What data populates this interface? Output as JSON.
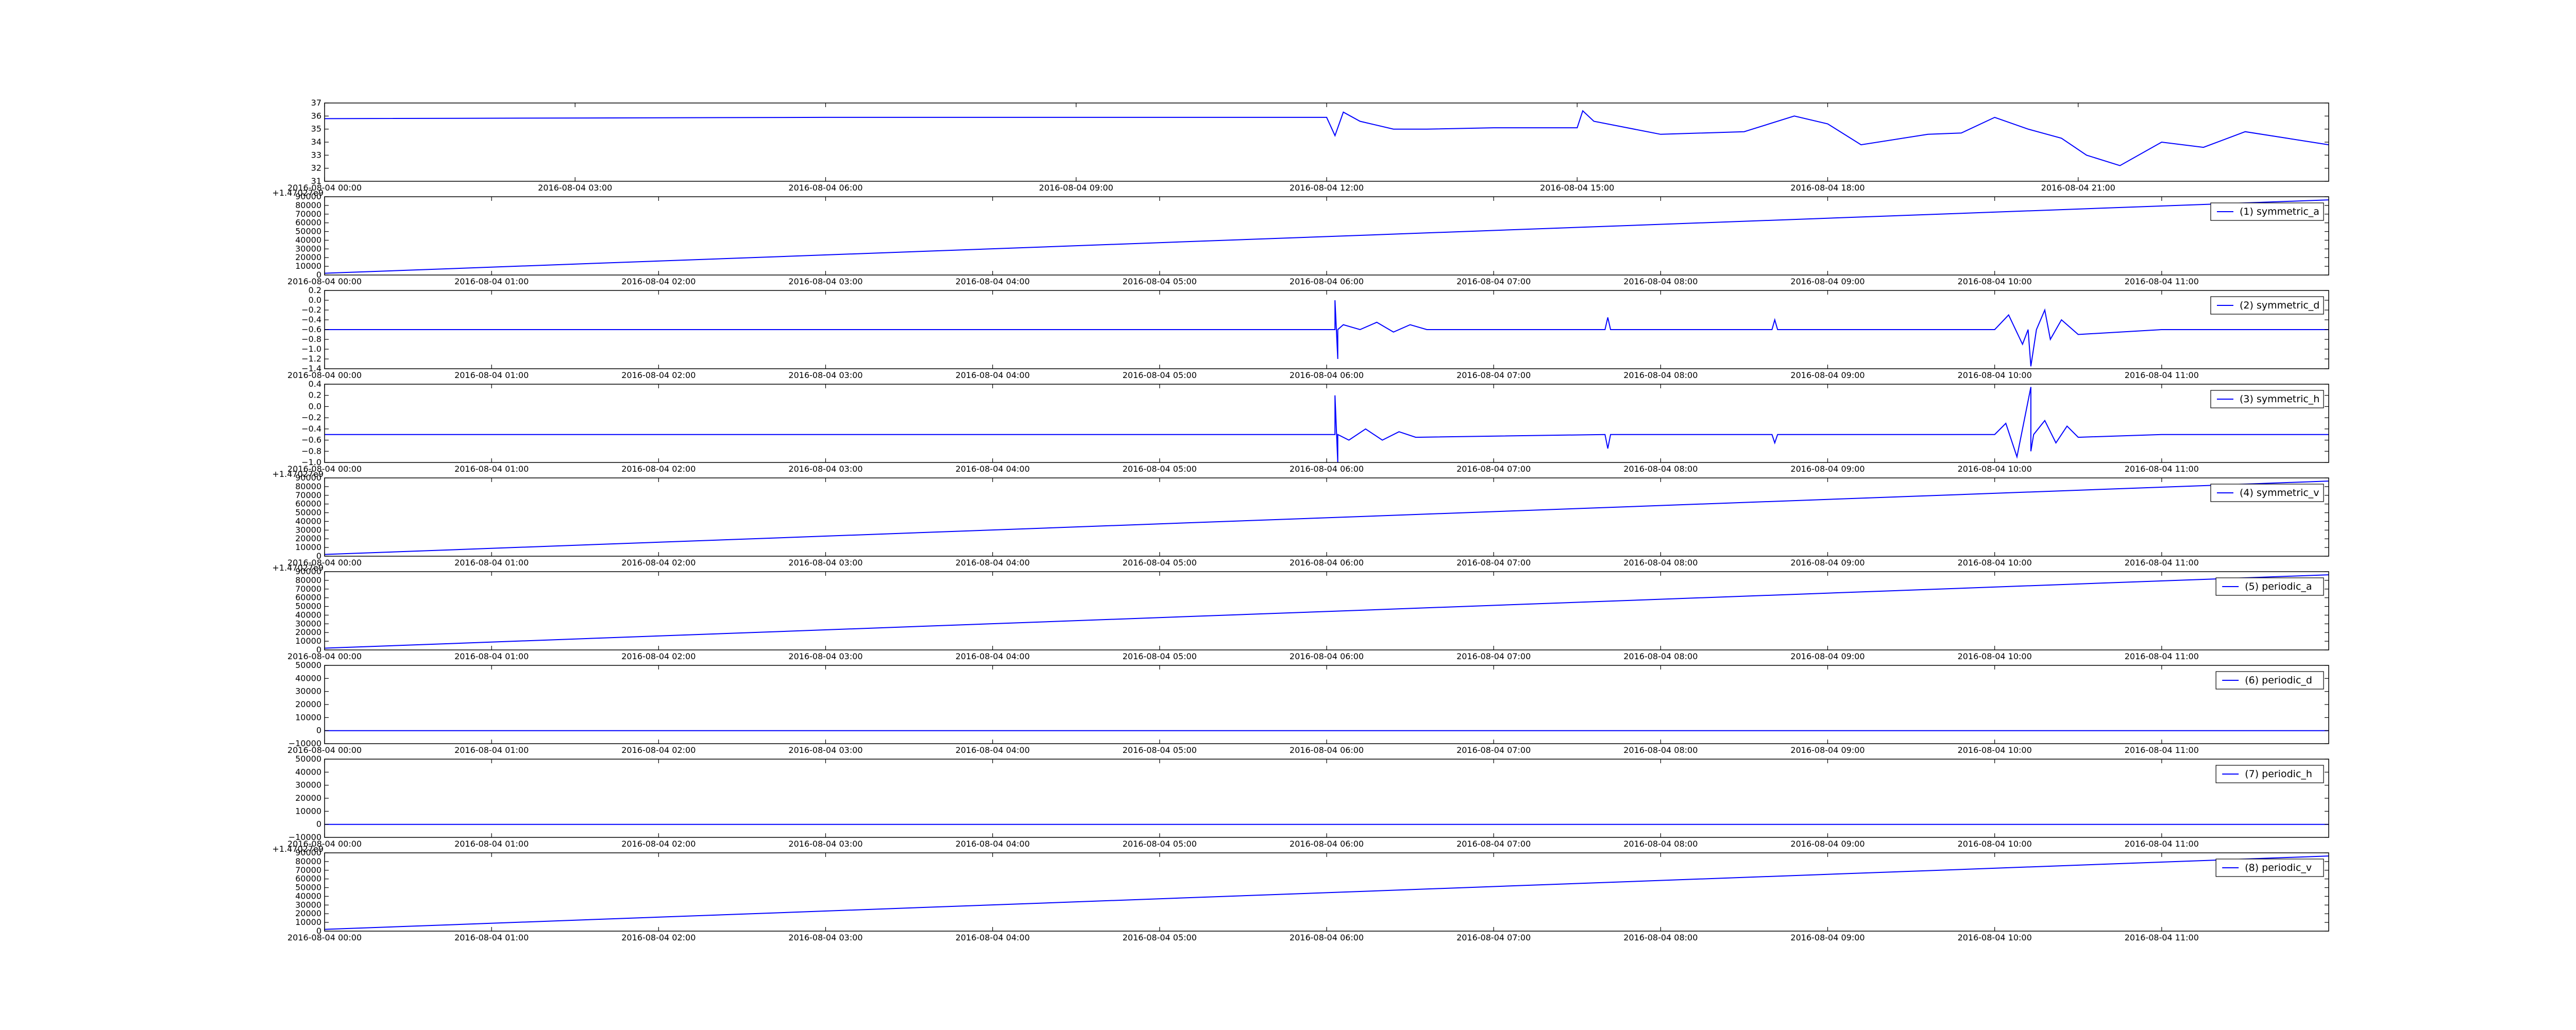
{
  "chart_data": [
    {
      "type": "line",
      "title": "",
      "xlabel": "",
      "ylabel": "",
      "grid": false,
      "legend": "",
      "color": "#0000ff",
      "ylim": [
        31,
        37
      ],
      "yticks": [
        "31",
        "32",
        "33",
        "34",
        "35",
        "36",
        "37"
      ],
      "xlim": [
        "2016-08-04 00:00",
        "2016-08-05 00:00"
      ],
      "xticks": [
        "2016-08-04 00:00",
        "2016-08-04 03:00",
        "2016-08-04 06:00",
        "2016-08-04 09:00",
        "2016-08-04 12:00",
        "2016-08-04 15:00",
        "2016-08-04 18:00",
        "2016-08-04 21:00"
      ],
      "offset_label": "",
      "series": [
        {
          "name": "",
          "x": [
            "2016-08-04 00:00",
            "2016-08-04 06:00",
            "2016-08-04 12:00",
            "2016-08-04 12:06",
            "2016-08-04 12:12",
            "2016-08-04 12:24",
            "2016-08-04 12:48",
            "2016-08-04 13:12",
            "2016-08-04 14:00",
            "2016-08-04 15:00",
            "2016-08-04 15:04",
            "2016-08-04 15:12",
            "2016-08-04 16:00",
            "2016-08-04 17:00",
            "2016-08-04 17:36",
            "2016-08-04 18:00",
            "2016-08-04 18:24",
            "2016-08-04 19:12",
            "2016-08-04 19:36",
            "2016-08-04 20:00",
            "2016-08-04 20:24",
            "2016-08-04 20:48",
            "2016-08-04 21:06",
            "2016-08-04 21:30",
            "2016-08-04 22:00",
            "2016-08-04 22:30",
            "2016-08-04 23:00",
            "2016-08-04 23:30",
            "2016-08-05 00:00"
          ],
          "y": [
            35.8,
            35.9,
            35.9,
            34.5,
            36.3,
            35.6,
            35.0,
            35.0,
            35.1,
            35.1,
            36.4,
            35.6,
            34.6,
            34.8,
            36.0,
            35.4,
            33.8,
            34.6,
            34.7,
            35.9,
            35.0,
            34.3,
            33.0,
            32.2,
            34.0,
            33.6,
            34.8,
            34.3,
            33.8
          ]
        }
      ]
    },
    {
      "type": "line",
      "title": "",
      "xlabel": "",
      "ylabel": "",
      "grid": false,
      "legend": "right",
      "color": "#0000ff",
      "ylim": [
        0,
        90000
      ],
      "yticks": [
        "0",
        "10000",
        "20000",
        "30000",
        "40000",
        "50000",
        "60000",
        "70000",
        "80000",
        "90000"
      ],
      "xlim": [
        "2016-08-04 00:00",
        "2016-08-04 12:00"
      ],
      "xticks": [
        "2016-08-04 00:00",
        "2016-08-04 01:00",
        "2016-08-04 02:00",
        "2016-08-04 03:00",
        "2016-08-04 04:00",
        "2016-08-04 05:00",
        "2016-08-04 06:00",
        "2016-08-04 07:00",
        "2016-08-04 08:00",
        "2016-08-04 09:00",
        "2016-08-04 10:00",
        "2016-08-04 11:00"
      ],
      "offset_label": "+1.47027e9",
      "series": [
        {
          "name": "(1) symmetric_a",
          "x": [
            "2016-08-04 00:00",
            "2016-08-04 12:00"
          ],
          "y": [
            2000,
            86400
          ]
        }
      ]
    },
    {
      "type": "line",
      "title": "",
      "xlabel": "",
      "ylabel": "",
      "grid": false,
      "legend": "right",
      "color": "#0000ff",
      "ylim": [
        -1.4,
        0.2
      ],
      "yticks": [
        "−1.4",
        "−1.2",
        "−1.0",
        "−0.8",
        "−0.6",
        "−0.4",
        "−0.2",
        "0.0",
        "0.2"
      ],
      "xlim": [
        "2016-08-04 00:00",
        "2016-08-04 12:00"
      ],
      "xticks": [
        "2016-08-04 00:00",
        "2016-08-04 01:00",
        "2016-08-04 02:00",
        "2016-08-04 03:00",
        "2016-08-04 04:00",
        "2016-08-04 05:00",
        "2016-08-04 06:00",
        "2016-08-04 07:00",
        "2016-08-04 08:00",
        "2016-08-04 09:00",
        "2016-08-04 10:00",
        "2016-08-04 11:00"
      ],
      "offset_label": "",
      "series": [
        {
          "name": "(2) symmetric_d",
          "x": [
            "2016-08-04 00:00",
            "2016-08-04 06:03",
            "2016-08-04 06:03",
            "2016-08-04 06:04",
            "2016-08-04 06:04",
            "2016-08-04 06:06",
            "2016-08-04 06:12",
            "2016-08-04 06:18",
            "2016-08-04 06:24",
            "2016-08-04 06:30",
            "2016-08-04 06:36",
            "2016-08-04 07:40",
            "2016-08-04 07:41",
            "2016-08-04 07:42",
            "2016-08-04 07:44",
            "2016-08-04 08:40",
            "2016-08-04 08:41",
            "2016-08-04 08:42",
            "2016-08-04 10:00",
            "2016-08-04 10:05",
            "2016-08-04 10:10",
            "2016-08-04 10:12",
            "2016-08-04 10:13",
            "2016-08-04 10:15",
            "2016-08-04 10:18",
            "2016-08-04 10:20",
            "2016-08-04 10:24",
            "2016-08-04 10:30",
            "2016-08-04 11:00",
            "2016-08-04 12:00"
          ],
          "y": [
            -0.6,
            -0.6,
            0.0,
            -1.2,
            -0.6,
            -0.5,
            -0.6,
            -0.45,
            -0.65,
            -0.5,
            -0.6,
            -0.6,
            -0.35,
            -0.6,
            -0.6,
            -0.6,
            -0.4,
            -0.6,
            -0.6,
            -0.3,
            -0.9,
            -0.6,
            -1.35,
            -0.6,
            -0.2,
            -0.8,
            -0.4,
            -0.7,
            -0.6,
            -0.6
          ]
        }
      ]
    },
    {
      "type": "line",
      "title": "",
      "xlabel": "",
      "ylabel": "",
      "grid": false,
      "legend": "right",
      "color": "#0000ff",
      "ylim": [
        -1.0,
        0.4
      ],
      "yticks": [
        "−1.0",
        "−0.8",
        "−0.6",
        "−0.4",
        "−0.2",
        "0.0",
        "0.2",
        "0.4"
      ],
      "xlim": [
        "2016-08-04 00:00",
        "2016-08-04 12:00"
      ],
      "xticks": [
        "2016-08-04 00:00",
        "2016-08-04 01:00",
        "2016-08-04 02:00",
        "2016-08-04 03:00",
        "2016-08-04 04:00",
        "2016-08-04 05:00",
        "2016-08-04 06:00",
        "2016-08-04 07:00",
        "2016-08-04 08:00",
        "2016-08-04 09:00",
        "2016-08-04 10:00",
        "2016-08-04 11:00"
      ],
      "offset_label": "",
      "series": [
        {
          "name": "(3) symmetric_h",
          "x": [
            "2016-08-04 00:00",
            "2016-08-04 06:03",
            "2016-08-04 06:03",
            "2016-08-04 06:04",
            "2016-08-04 06:04",
            "2016-08-04 06:08",
            "2016-08-04 06:14",
            "2016-08-04 06:20",
            "2016-08-04 06:26",
            "2016-08-04 06:32",
            "2016-08-04 07:40",
            "2016-08-04 07:41",
            "2016-08-04 07:42",
            "2016-08-04 08:40",
            "2016-08-04 08:41",
            "2016-08-04 08:42",
            "2016-08-04 10:00",
            "2016-08-04 10:04",
            "2016-08-04 10:08",
            "2016-08-04 10:13",
            "2016-08-04 10:13",
            "2016-08-04 10:14",
            "2016-08-04 10:18",
            "2016-08-04 10:22",
            "2016-08-04 10:26",
            "2016-08-04 10:30",
            "2016-08-04 11:00",
            "2016-08-04 12:00"
          ],
          "y": [
            -0.5,
            -0.5,
            0.2,
            -1.0,
            -0.5,
            -0.6,
            -0.4,
            -0.6,
            -0.45,
            -0.55,
            -0.5,
            -0.75,
            -0.5,
            -0.5,
            -0.65,
            -0.5,
            -0.5,
            -0.3,
            -0.9,
            0.35,
            -0.8,
            -0.5,
            -0.25,
            -0.65,
            -0.35,
            -0.55,
            -0.5,
            -0.5
          ]
        }
      ]
    },
    {
      "type": "line",
      "title": "",
      "xlabel": "",
      "ylabel": "",
      "grid": false,
      "legend": "right",
      "color": "#0000ff",
      "ylim": [
        0,
        90000
      ],
      "yticks": [
        "0",
        "10000",
        "20000",
        "30000",
        "40000",
        "50000",
        "60000",
        "70000",
        "80000",
        "90000"
      ],
      "xlim": [
        "2016-08-04 00:00",
        "2016-08-04 12:00"
      ],
      "xticks": [
        "2016-08-04 00:00",
        "2016-08-04 01:00",
        "2016-08-04 02:00",
        "2016-08-04 03:00",
        "2016-08-04 04:00",
        "2016-08-04 05:00",
        "2016-08-04 06:00",
        "2016-08-04 07:00",
        "2016-08-04 08:00",
        "2016-08-04 09:00",
        "2016-08-04 10:00",
        "2016-08-04 11:00"
      ],
      "offset_label": "+1.47027e9",
      "series": [
        {
          "name": "(4) symmetric_v",
          "x": [
            "2016-08-04 00:00",
            "2016-08-04 12:00"
          ],
          "y": [
            2000,
            86400
          ]
        }
      ]
    },
    {
      "type": "line",
      "title": "",
      "xlabel": "",
      "ylabel": "",
      "grid": false,
      "legend": "right",
      "color": "#0000ff",
      "ylim": [
        0,
        90000
      ],
      "yticks": [
        "0",
        "10000",
        "20000",
        "30000",
        "40000",
        "50000",
        "60000",
        "70000",
        "80000",
        "90000"
      ],
      "xlim": [
        "2016-08-04 00:00",
        "2016-08-04 12:00"
      ],
      "xticks": [
        "2016-08-04 00:00",
        "2016-08-04 01:00",
        "2016-08-04 02:00",
        "2016-08-04 03:00",
        "2016-08-04 04:00",
        "2016-08-04 05:00",
        "2016-08-04 06:00",
        "2016-08-04 07:00",
        "2016-08-04 08:00",
        "2016-08-04 09:00",
        "2016-08-04 10:00",
        "2016-08-04 11:00"
      ],
      "offset_label": "+1.47027e9",
      "series": [
        {
          "name": "(5) periodic_a",
          "x": [
            "2016-08-04 00:00",
            "2016-08-04 12:00"
          ],
          "y": [
            2000,
            86400
          ]
        }
      ]
    },
    {
      "type": "line",
      "title": "",
      "xlabel": "",
      "ylabel": "",
      "grid": false,
      "legend": "right",
      "color": "#0000ff",
      "ylim": [
        -10000,
        50000
      ],
      "yticks": [
        "−10000",
        "0",
        "10000",
        "20000",
        "30000",
        "40000",
        "50000"
      ],
      "xlim": [
        "2016-08-04 00:00",
        "2016-08-04 12:00"
      ],
      "xticks": [
        "2016-08-04 00:00",
        "2016-08-04 01:00",
        "2016-08-04 02:00",
        "2016-08-04 03:00",
        "2016-08-04 04:00",
        "2016-08-04 05:00",
        "2016-08-04 06:00",
        "2016-08-04 07:00",
        "2016-08-04 08:00",
        "2016-08-04 09:00",
        "2016-08-04 10:00",
        "2016-08-04 11:00"
      ],
      "offset_label": "",
      "series": [
        {
          "name": "(6) periodic_d",
          "x": [
            "2016-08-04 00:00",
            "2016-08-04 12:00"
          ],
          "y": [
            0,
            0
          ]
        }
      ]
    },
    {
      "type": "line",
      "title": "",
      "xlabel": "",
      "ylabel": "",
      "grid": false,
      "legend": "right",
      "color": "#0000ff",
      "ylim": [
        -10000,
        50000
      ],
      "yticks": [
        "−10000",
        "0",
        "10000",
        "20000",
        "30000",
        "40000",
        "50000"
      ],
      "xlim": [
        "2016-08-04 00:00",
        "2016-08-04 12:00"
      ],
      "xticks": [
        "2016-08-04 00:00",
        "2016-08-04 01:00",
        "2016-08-04 02:00",
        "2016-08-04 03:00",
        "2016-08-04 04:00",
        "2016-08-04 05:00",
        "2016-08-04 06:00",
        "2016-08-04 07:00",
        "2016-08-04 08:00",
        "2016-08-04 09:00",
        "2016-08-04 10:00",
        "2016-08-04 11:00"
      ],
      "offset_label": "",
      "series": [
        {
          "name": "(7) periodic_h",
          "x": [
            "2016-08-04 00:00",
            "2016-08-04 12:00"
          ],
          "y": [
            0,
            0
          ]
        }
      ]
    },
    {
      "type": "line",
      "title": "",
      "xlabel": "",
      "ylabel": "",
      "grid": false,
      "legend": "right",
      "color": "#0000ff",
      "ylim": [
        0,
        90000
      ],
      "yticks": [
        "0",
        "10000",
        "20000",
        "30000",
        "40000",
        "50000",
        "60000",
        "70000",
        "80000",
        "90000"
      ],
      "xlim": [
        "2016-08-04 00:00",
        "2016-08-04 12:00"
      ],
      "xticks": [
        "2016-08-04 00:00",
        "2016-08-04 01:00",
        "2016-08-04 02:00",
        "2016-08-04 03:00",
        "2016-08-04 04:00",
        "2016-08-04 05:00",
        "2016-08-04 06:00",
        "2016-08-04 07:00",
        "2016-08-04 08:00",
        "2016-08-04 09:00",
        "2016-08-04 10:00",
        "2016-08-04 11:00"
      ],
      "offset_label": "+1.47027e9",
      "series": [
        {
          "name": "(8) periodic_v",
          "x": [
            "2016-08-04 00:00",
            "2016-08-04 12:00"
          ],
          "y": [
            2000,
            86400
          ]
        }
      ]
    }
  ]
}
